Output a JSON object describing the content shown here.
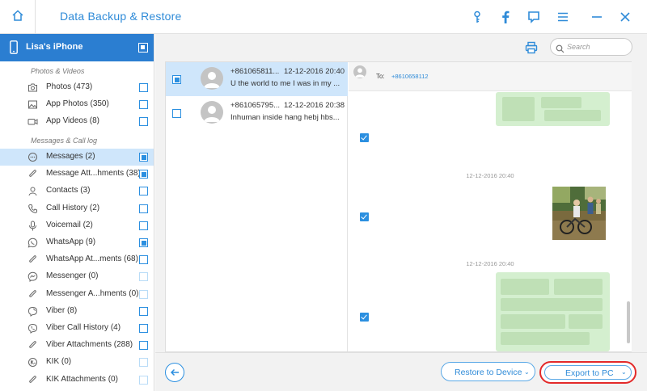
{
  "window": {
    "title": "Data Backup & Restore"
  },
  "titlebar_icons": [
    "home-icon",
    "key-icon",
    "facebook-icon",
    "feedback-icon",
    "menu-icon",
    "minimize-icon",
    "close-icon"
  ],
  "accent_color": "#2b7ed1",
  "highlight_color": "#e32a2a",
  "device": {
    "name": "Lisa's iPhone",
    "checked": true
  },
  "sidebar": {
    "photos_section": "Photos & Videos",
    "calllog_section": "Messages & Call log",
    "items": [
      {
        "label": "Photos (473)",
        "icon": "photo-icon",
        "state": "unchecked"
      },
      {
        "label": "App Photos (350)",
        "icon": "image-icon",
        "state": "unchecked"
      },
      {
        "label": "App Videos (8)",
        "icon": "video-icon",
        "state": "unchecked"
      },
      {
        "label": "Messages (2)",
        "icon": "message-icon",
        "state": "checked",
        "selected": true
      },
      {
        "label": "Message Att...hments (38)",
        "icon": "paperclip-icon",
        "state": "checked"
      },
      {
        "label": "Contacts (3)",
        "icon": "person-icon",
        "state": "unchecked"
      },
      {
        "label": "Call History (2)",
        "icon": "phone-icon",
        "state": "unchecked"
      },
      {
        "label": "Voicemail (2)",
        "icon": "microphone-icon",
        "state": "unchecked"
      },
      {
        "label": "WhatsApp (9)",
        "icon": "whatsapp-icon",
        "state": "checked"
      },
      {
        "label": "WhatsApp At...ments (68)",
        "icon": "paperclip-icon",
        "state": "unchecked"
      },
      {
        "label": "Messenger (0)",
        "icon": "messenger-icon",
        "state": "disabled"
      },
      {
        "label": "Messenger A...hments (0)",
        "icon": "paperclip-icon",
        "state": "disabled"
      },
      {
        "label": "Viber (8)",
        "icon": "viber-icon",
        "state": "unchecked"
      },
      {
        "label": "Viber Call History (4)",
        "icon": "viber-call-icon",
        "state": "unchecked"
      },
      {
        "label": "Viber Attachments (288)",
        "icon": "paperclip-icon",
        "state": "unchecked"
      },
      {
        "label": "KIK (0)",
        "icon": "kik-icon",
        "state": "disabled"
      },
      {
        "label": "KIK Attachments (0)",
        "icon": "paperclip-icon",
        "state": "disabled"
      }
    ]
  },
  "search": {
    "placeholder": "Search",
    "value": ""
  },
  "threads": [
    {
      "number": "+861065811...",
      "time": "12-12-2016 20:40",
      "preview": "U the world to me I was in my ...",
      "checked": true,
      "selected": true
    },
    {
      "number": "+861065795...",
      "time": "12-12-2016 20:38",
      "preview": "Inhuman inside hang hebj hbs...",
      "checked": false,
      "selected": false
    }
  ],
  "conversation": {
    "to_label": "To:",
    "to_number": "+8610658112",
    "timestamps": [
      "12-12-2016 20:40",
      "12-12-2016 20:40"
    ]
  },
  "buttons": {
    "restore": "Restore to Device",
    "export": "Export to PC"
  }
}
